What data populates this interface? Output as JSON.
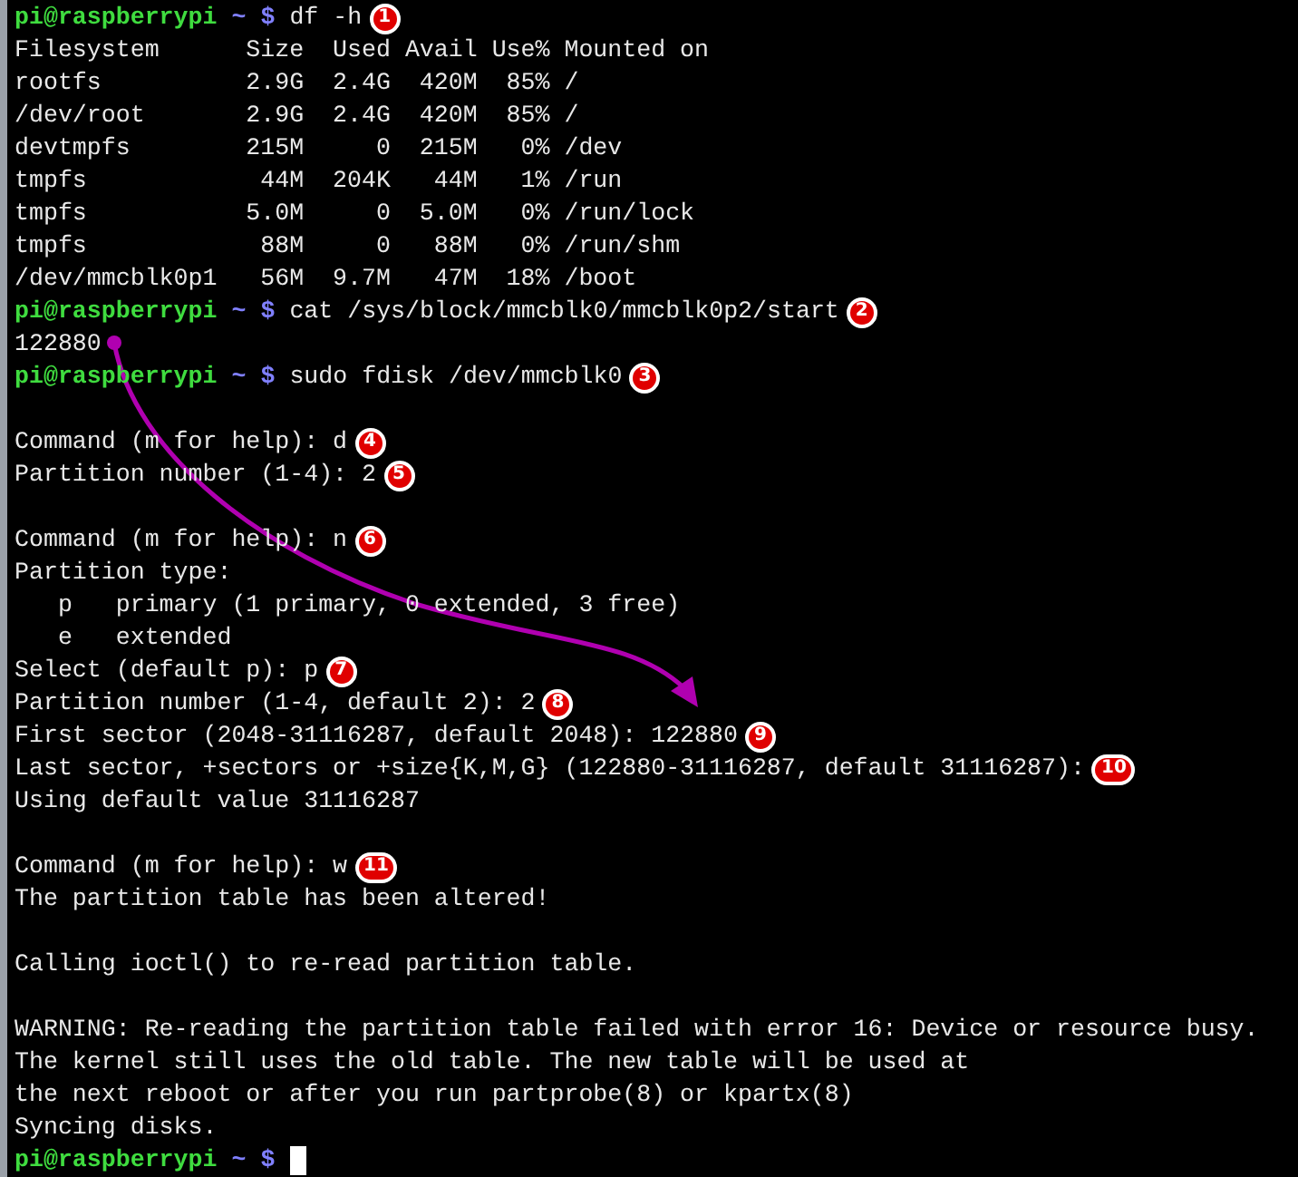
{
  "lines": [
    {
      "kind": "prompt",
      "user": "pi@raspberrypi",
      "path": "~",
      "symbol": "$",
      "text": "df -h",
      "marker": "1"
    },
    {
      "kind": "output",
      "text": "Filesystem      Size  Used Avail Use% Mounted on"
    },
    {
      "kind": "output",
      "text": "rootfs          2.9G  2.4G  420M  85% /"
    },
    {
      "kind": "output",
      "text": "/dev/root       2.9G  2.4G  420M  85% /"
    },
    {
      "kind": "output",
      "text": "devtmpfs        215M     0  215M   0% /dev"
    },
    {
      "kind": "output",
      "text": "tmpfs            44M  204K   44M   1% /run"
    },
    {
      "kind": "output",
      "text": "tmpfs           5.0M     0  5.0M   0% /run/lock"
    },
    {
      "kind": "output",
      "text": "tmpfs            88M     0   88M   0% /run/shm"
    },
    {
      "kind": "output",
      "text": "/dev/mmcblk0p1   56M  9.7M   47M  18% /boot"
    },
    {
      "kind": "prompt",
      "user": "pi@raspberrypi",
      "path": "~",
      "symbol": "$",
      "text": "cat /sys/block/mmcblk0/mmcblk0p2/start",
      "marker": "2"
    },
    {
      "kind": "output",
      "text": "122880"
    },
    {
      "kind": "prompt",
      "user": "pi@raspberrypi",
      "path": "~",
      "symbol": "$",
      "text": "sudo fdisk /dev/mmcblk0",
      "marker": "3"
    },
    {
      "kind": "blank"
    },
    {
      "kind": "output",
      "text": "Command (m for help): d",
      "marker": "4"
    },
    {
      "kind": "output",
      "text": "Partition number (1-4): 2",
      "marker": "5"
    },
    {
      "kind": "blank"
    },
    {
      "kind": "output",
      "text": "Command (m for help): n",
      "marker": "6"
    },
    {
      "kind": "output",
      "text": "Partition type:"
    },
    {
      "kind": "output",
      "text": "   p   primary (1 primary, 0 extended, 3 free)"
    },
    {
      "kind": "output",
      "text": "   e   extended"
    },
    {
      "kind": "output",
      "text": "Select (default p): p",
      "marker": "7"
    },
    {
      "kind": "output",
      "text": "Partition number (1-4, default 2): 2",
      "marker": "8"
    },
    {
      "kind": "output",
      "text": "First sector (2048-31116287, default 2048): 122880",
      "marker": "9"
    },
    {
      "kind": "output",
      "text": "Last sector, +sectors or +size{K,M,G} (122880-31116287, default 31116287):",
      "marker": "10"
    },
    {
      "kind": "output",
      "text": "Using default value 31116287"
    },
    {
      "kind": "blank"
    },
    {
      "kind": "output",
      "text": "Command (m for help): w",
      "marker": "11"
    },
    {
      "kind": "output",
      "text": "The partition table has been altered!"
    },
    {
      "kind": "blank"
    },
    {
      "kind": "output",
      "text": "Calling ioctl() to re-read partition table."
    },
    {
      "kind": "blank"
    },
    {
      "kind": "output",
      "text": "WARNING: Re-reading the partition table failed with error 16: Device or resource busy."
    },
    {
      "kind": "output",
      "text": "The kernel still uses the old table. The new table will be used at"
    },
    {
      "kind": "output",
      "text": "the next reboot or after you run partprobe(8) or kpartx(8)"
    },
    {
      "kind": "output",
      "text": "Syncing disks."
    },
    {
      "kind": "prompt",
      "user": "pi@raspberrypi",
      "path": "~",
      "symbol": "$",
      "cursor": true
    }
  ]
}
